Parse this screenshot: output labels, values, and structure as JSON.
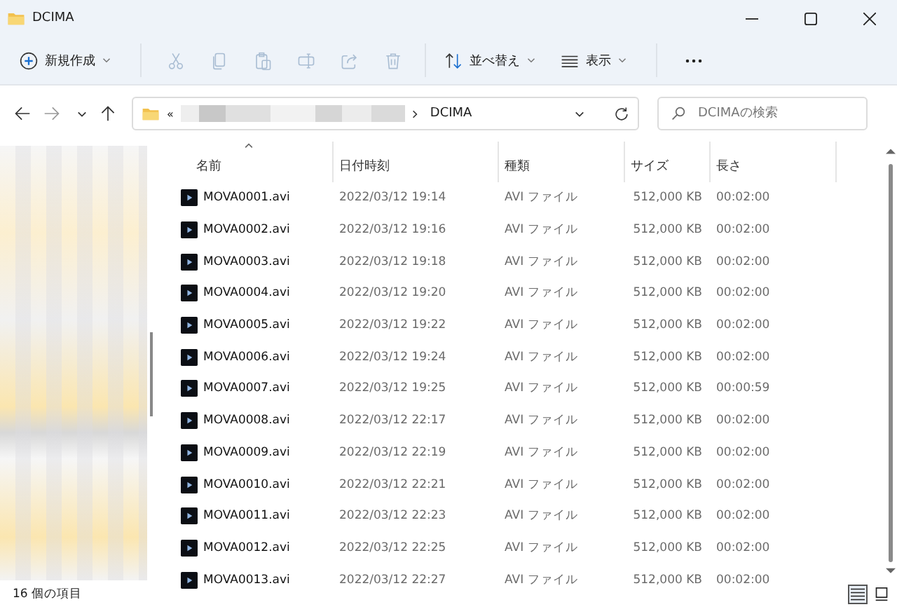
{
  "window": {
    "title": "DCIMA"
  },
  "toolbar": {
    "new_label": "新規作成",
    "sort_label": "並べ替え",
    "view_label": "表示"
  },
  "address_bar": {
    "overflow": "«",
    "folder": "DCIMA"
  },
  "search": {
    "placeholder": "DCIMAの検索"
  },
  "columns": [
    {
      "label": "名前",
      "sorted": true
    },
    {
      "label": "日付時刻",
      "sorted": false
    },
    {
      "label": "種類",
      "sorted": false
    },
    {
      "label": "サイズ",
      "sorted": false
    },
    {
      "label": "長さ",
      "sorted": false
    }
  ],
  "rows": [
    {
      "name": "MOVA0001.avi",
      "date": "2022/03/12 19:14",
      "type": "AVI ファイル",
      "size": "512,000 KB",
      "length": "00:02:00"
    },
    {
      "name": "MOVA0002.avi",
      "date": "2022/03/12 19:16",
      "type": "AVI ファイル",
      "size": "512,000 KB",
      "length": "00:02:00"
    },
    {
      "name": "MOVA0003.avi",
      "date": "2022/03/12 19:18",
      "type": "AVI ファイル",
      "size": "512,000 KB",
      "length": "00:02:00"
    },
    {
      "name": "MOVA0004.avi",
      "date": "2022/03/12 19:20",
      "type": "AVI ファイル",
      "size": "512,000 KB",
      "length": "00:02:00"
    },
    {
      "name": "MOVA0005.avi",
      "date": "2022/03/12 19:22",
      "type": "AVI ファイル",
      "size": "512,000 KB",
      "length": "00:02:00"
    },
    {
      "name": "MOVA0006.avi",
      "date": "2022/03/12 19:24",
      "type": "AVI ファイル",
      "size": "512,000 KB",
      "length": "00:02:00"
    },
    {
      "name": "MOVA0007.avi",
      "date": "2022/03/12 19:25",
      "type": "AVI ファイル",
      "size": "512,000 KB",
      "length": "00:00:59"
    },
    {
      "name": "MOVA0008.avi",
      "date": "2022/03/12 22:17",
      "type": "AVI ファイル",
      "size": "512,000 KB",
      "length": "00:02:00"
    },
    {
      "name": "MOVA0009.avi",
      "date": "2022/03/12 22:19",
      "type": "AVI ファイル",
      "size": "512,000 KB",
      "length": "00:02:00"
    },
    {
      "name": "MOVA0010.avi",
      "date": "2022/03/12 22:21",
      "type": "AVI ファイル",
      "size": "512,000 KB",
      "length": "00:02:00"
    },
    {
      "name": "MOVA0011.avi",
      "date": "2022/03/12 22:23",
      "type": "AVI ファイル",
      "size": "512,000 KB",
      "length": "00:02:00"
    },
    {
      "name": "MOVA0012.avi",
      "date": "2022/03/12 22:25",
      "type": "AVI ファイル",
      "size": "512,000 KB",
      "length": "00:02:00"
    },
    {
      "name": "MOVA0013.avi",
      "date": "2022/03/12 22:27",
      "type": "AVI ファイル",
      "size": "512,000 KB",
      "length": "00:02:00"
    }
  ],
  "status_bar": {
    "item_count": "16 個の項目"
  },
  "view_buttons": [
    {
      "kind": "details",
      "selected": true
    },
    {
      "kind": "tiles",
      "selected": false
    }
  ]
}
